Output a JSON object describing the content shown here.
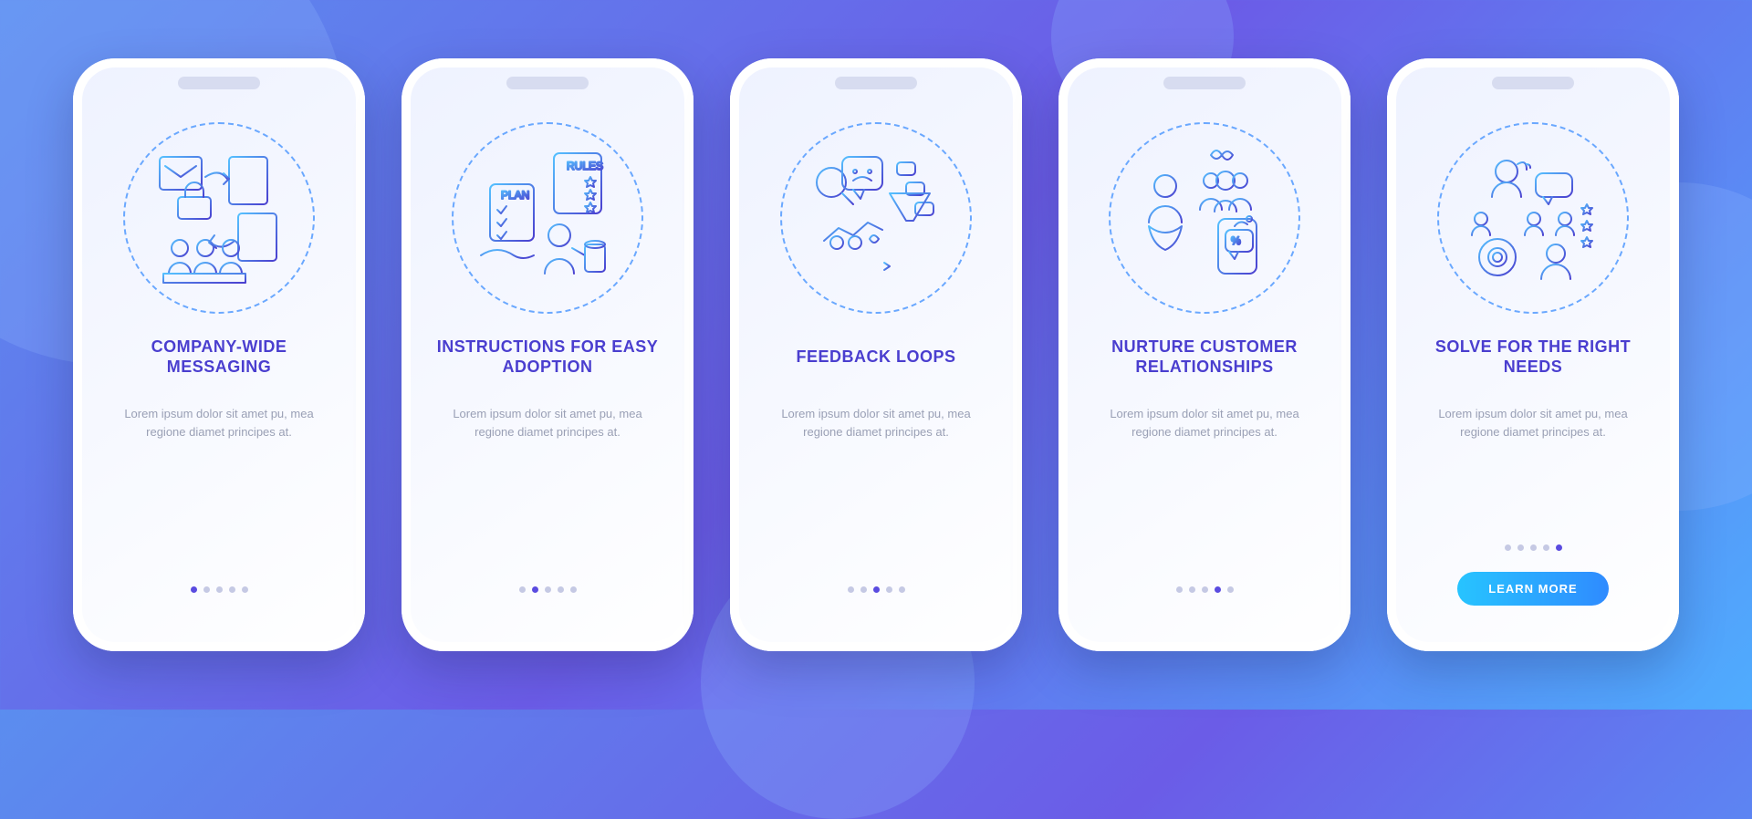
{
  "common_body": "Lorem ipsum dolor sit amet pu, mea regione diamet principes at.",
  "cta_label": "LEARN MORE",
  "screens": [
    {
      "title": "COMPANY-WIDE MESSAGING",
      "active_dot": 0,
      "icon": "messaging-icon",
      "cta": false
    },
    {
      "title": "INSTRUCTIONS FOR EASY ADOPTION",
      "active_dot": 1,
      "icon": "instructions-icon",
      "cta": false
    },
    {
      "title": "FEEDBACK LOOPS",
      "active_dot": 2,
      "icon": "feedback-icon",
      "cta": false
    },
    {
      "title": "NURTURE CUSTOMER RELATIONSHIPS",
      "active_dot": 3,
      "icon": "nurture-icon",
      "cta": false
    },
    {
      "title": "SOLVE FOR THE RIGHT NEEDS",
      "active_dot": 4,
      "icon": "target-icon",
      "cta": true
    }
  ],
  "colors": {
    "accent_purple": "#4a3ecf",
    "body_grey": "#9aa0b5",
    "gradient_from": "#27c4ff",
    "gradient_to": "#2f8bff"
  }
}
